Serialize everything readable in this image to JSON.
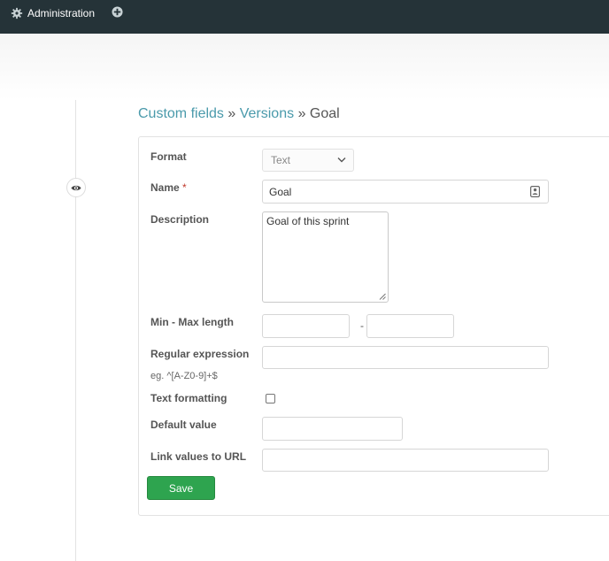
{
  "topbar": {
    "administration_label": "Administration"
  },
  "breadcrumb": {
    "items": [
      {
        "label": "Custom fields"
      },
      {
        "label": "Versions"
      }
    ],
    "separator": "»",
    "current": "Goal"
  },
  "form": {
    "format": {
      "label": "Format",
      "value": "Text"
    },
    "name": {
      "label": "Name",
      "required_mark": "*",
      "value": "Goal"
    },
    "description": {
      "label": "Description",
      "value": "Goal of this sprint"
    },
    "length": {
      "label": "Min - Max length",
      "separator": "-",
      "min": "",
      "max": ""
    },
    "regexp": {
      "label": "Regular expression",
      "hint": "eg. ^[A-Z0-9]+$",
      "value": ""
    },
    "text_formatting": {
      "label": "Text formatting",
      "checked": false
    },
    "default_value": {
      "label": "Default value",
      "value": ""
    },
    "url_pattern": {
      "label": "Link values to URL",
      "value": ""
    },
    "save_label": "Save"
  },
  "colors": {
    "topbar": "#253338",
    "link": "#4a9aab",
    "save": "#2ea44f"
  },
  "icons": {
    "admin": "gear-icon",
    "new": "plus-circle-icon",
    "sidebar_toggle": "eye-icon"
  }
}
